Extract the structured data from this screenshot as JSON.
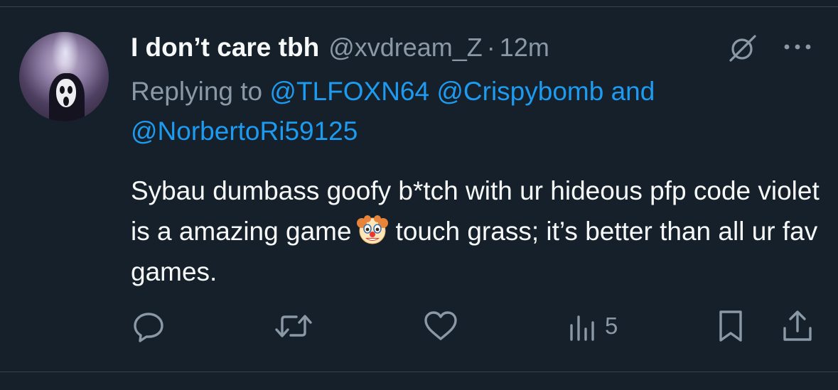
{
  "tweet": {
    "display_name": "I don’t care tbh",
    "handle": "@xvdream_Z",
    "separator": "·",
    "time": "12m",
    "reply_prefix": "Replying to",
    "mention_1": "@TLFOXN64",
    "mention_2": "@Crispybomb",
    "and_word": "and",
    "mention_3": "@NorbertoRi59125",
    "text_part1": "Sybau dumbass goofy b*tch with ur hideous pfp code violet is a amazing game",
    "text_part2": "touch grass; it’s better than all ur fav games.",
    "emoji": "🤡",
    "views_count": "5"
  },
  "icons": {
    "reply": "reply-bubble-icon",
    "retweet": "retweet-icon",
    "like": "heart-icon",
    "views": "analytics-bars-icon",
    "bookmark": "bookmark-icon",
    "share": "share-icon",
    "grok": "grok-icon",
    "more": "more-dots-icon"
  },
  "colors": {
    "background": "#15202b",
    "text": "#f7f9f9",
    "muted": "#8b98a5",
    "link": "#1d9bf0",
    "divider": "#38444d"
  }
}
